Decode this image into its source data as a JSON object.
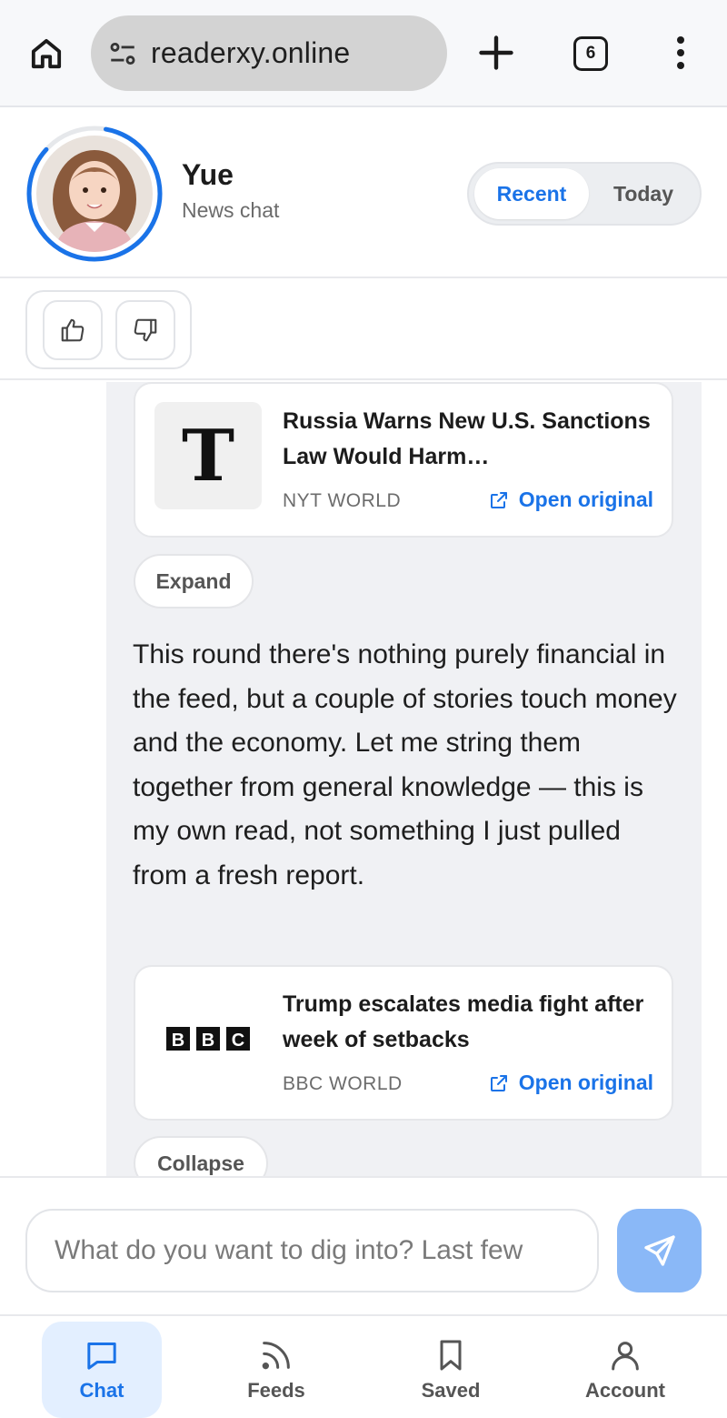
{
  "browser": {
    "url": "readerxy.online",
    "tab_count": "6",
    "icons": [
      "home-icon",
      "site-settings-icon",
      "new-tab-icon",
      "tabs-icon",
      "more-vert-icon"
    ]
  },
  "header": {
    "name": "Yue",
    "subtitle": "News chat",
    "filters": {
      "recent": "Recent",
      "today": "Today",
      "selected": "Recent"
    }
  },
  "feedback": {
    "icons": [
      "thumbs-up-icon",
      "thumbs-down-icon"
    ]
  },
  "messages": {
    "card1": {
      "title": "Russia Warns New U.S. Sanctions Law Would Harm…",
      "source": "NYT WORLD",
      "link": "Open original",
      "logo_text": "T"
    },
    "expand_label": "Expand",
    "body": "This round there's nothing purely financial in the feed, but a couple of stories touch money and the economy. Let me string them together from general knowledge — this is my own read, not something I just pulled from a fresh report.",
    "card2": {
      "title": "Trump escalates media fight after week of setbacks",
      "source": "BBC WORLD",
      "link": "Open original",
      "logo_letters": [
        "B",
        "B",
        "C"
      ]
    },
    "collapse_label": "Collapse"
  },
  "input": {
    "placeholder": "What do you want to dig into? Last few"
  },
  "nav": {
    "chat": "Chat",
    "feeds": "Feeds",
    "saved": "Saved",
    "account": "Account",
    "active": "Chat"
  },
  "colors": {
    "accent": "#1a73e8",
    "send_button": "#8ab8f7",
    "bubble_bg": "#f0f1f4",
    "active_nav_bg": "#e3efff"
  }
}
